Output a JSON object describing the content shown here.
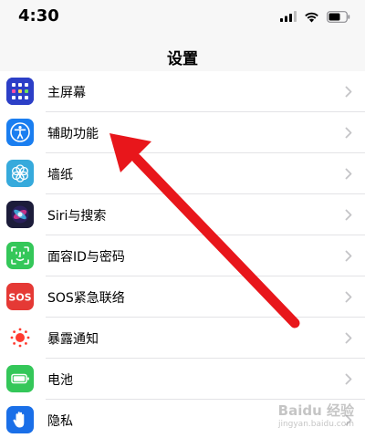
{
  "status_bar": {
    "time": "4:30"
  },
  "nav": {
    "title": "设置"
  },
  "rows": [
    {
      "label": "主屏幕",
      "icon": "home-screen-grid-icon",
      "color": "#2c3fc7"
    },
    {
      "label": "辅助功能",
      "icon": "accessibility-icon",
      "color": "#1a7ef0"
    },
    {
      "label": "墙纸",
      "icon": "wallpaper-flower-icon",
      "color": "#36aadc"
    },
    {
      "label": "Siri与搜索",
      "icon": "siri-icon",
      "color": "#1c1c3a"
    },
    {
      "label": "面容ID与密码",
      "icon": "face-id-icon",
      "color": "#34c759"
    },
    {
      "label": "SOS紧急联络",
      "icon": "sos-icon",
      "color": "#e53935"
    },
    {
      "label": "暴露通知",
      "icon": "exposure-notification-icon",
      "color": "#ffffff"
    },
    {
      "label": "电池",
      "icon": "battery-icon",
      "color": "#34c759"
    },
    {
      "label": "隐私",
      "icon": "privacy-hand-icon",
      "color": "#1a6fe8"
    }
  ],
  "annotation": {
    "arrow_color": "#e8161b"
  },
  "watermark": {
    "top": "Baidu 经验",
    "bottom": "jingyan.baidu.com"
  }
}
